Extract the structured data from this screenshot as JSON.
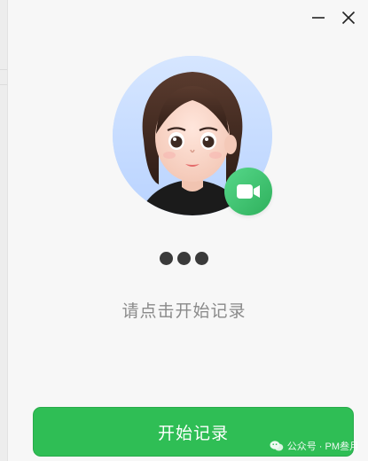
{
  "window": {
    "minimize_icon": "minimize-icon",
    "close_icon": "close-icon"
  },
  "avatar": {
    "badge_icon": "video-camera-icon",
    "badge_color": "#3cc26a"
  },
  "status": {
    "dots_count": 3
  },
  "hint_text": "请点击开始记录",
  "start_button_label": "开始记录",
  "watermark": {
    "text": "公众号 · PM叁月"
  },
  "colors": {
    "accent": "#2fbe55",
    "hint": "#8a8a8a"
  }
}
